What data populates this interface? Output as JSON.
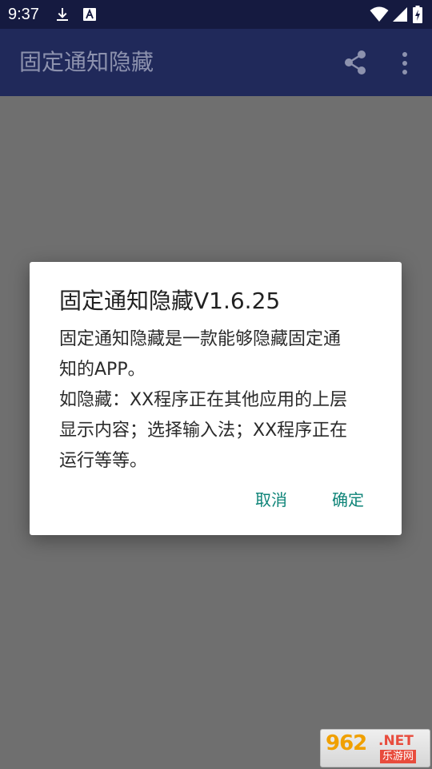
{
  "status_bar": {
    "time": "9:37",
    "icons": [
      "download-icon",
      "font-notification-icon",
      "wifi-icon",
      "signal-icon",
      "battery-charging-icon"
    ]
  },
  "app_bar": {
    "title": "固定通知隐藏",
    "actions": [
      "share-icon",
      "more-vertical-icon"
    ]
  },
  "dialog": {
    "title": "固定通知隐藏V1.6.25",
    "message_lines": [
      "固定通知隐藏是一款能够隐藏固定通",
      "知的APP。",
      "如隐藏：XX程序正在其他应用的上层",
      "显示内容；选择输入法；XX程序正在",
      "运行等等。"
    ],
    "cancel_label": "取消",
    "confirm_label": "确定"
  },
  "watermark": {
    "number": "962",
    "suffix": ".NET",
    "site_name": "乐游网"
  },
  "colors": {
    "status_bar": "#151a40",
    "app_bar": "#20295a",
    "scrim": "#6f6f6f",
    "accent": "#0e8478"
  }
}
